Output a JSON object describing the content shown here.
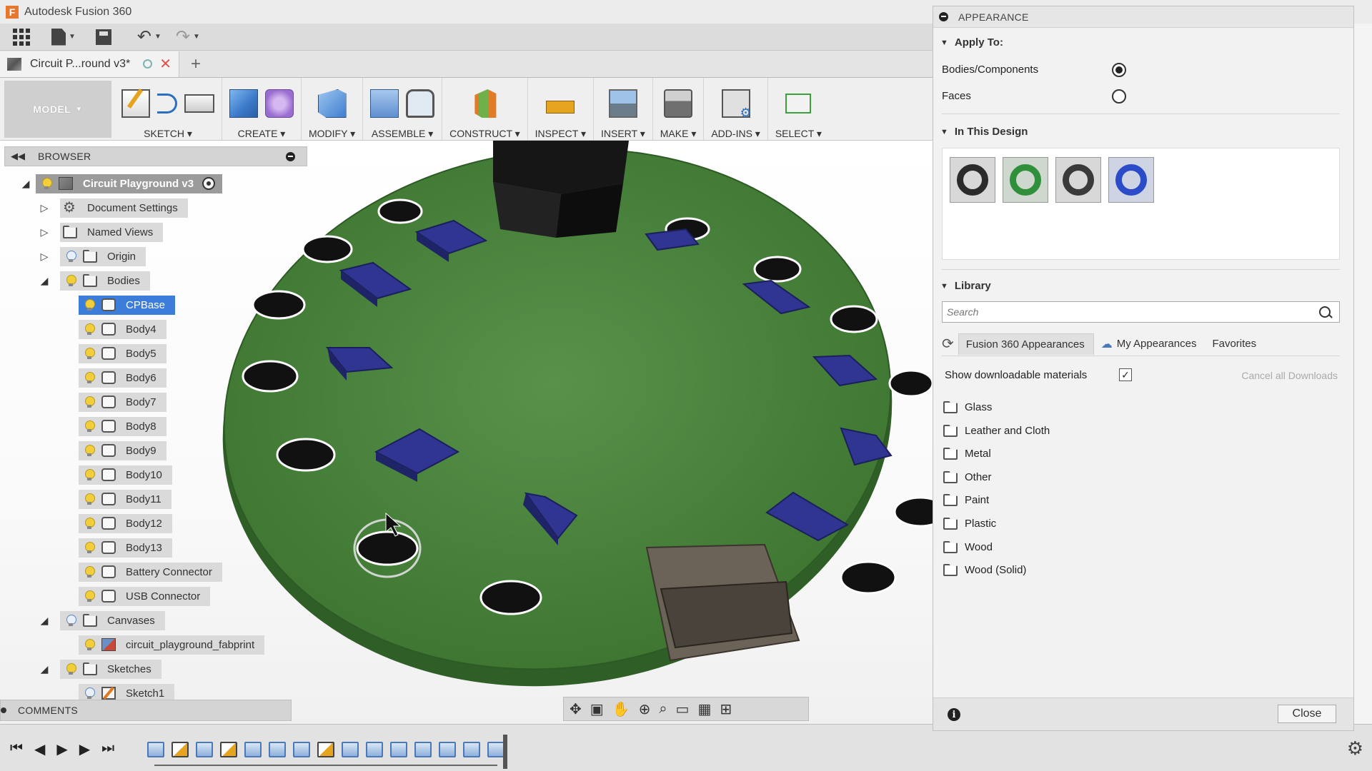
{
  "app": {
    "title": "Autodesk Fusion 360",
    "logo_letter": "F"
  },
  "document_tab": {
    "label": "Circuit P...round v3*",
    "close_glyph": "✕",
    "new_tab_glyph": "+"
  },
  "ribbon": {
    "workspace": "MODEL",
    "groups": [
      {
        "label": "SKETCH ▾"
      },
      {
        "label": "CREATE ▾"
      },
      {
        "label": "MODIFY ▾"
      },
      {
        "label": "ASSEMBLE ▾"
      },
      {
        "label": "CONSTRUCT ▾"
      },
      {
        "label": "INSPECT ▾"
      },
      {
        "label": "INSERT ▾"
      },
      {
        "label": "MAKE ▾"
      },
      {
        "label": "ADD-INS ▾"
      },
      {
        "label": "SELECT ▾"
      }
    ]
  },
  "browser": {
    "title": "BROWSER",
    "root": "Circuit Playground v3",
    "items": [
      {
        "label": "Document Settings"
      },
      {
        "label": "Named Views"
      },
      {
        "label": "Origin"
      },
      {
        "label": "Bodies"
      },
      {
        "label": "CPBase"
      },
      {
        "label": "Body4"
      },
      {
        "label": "Body5"
      },
      {
        "label": "Body6"
      },
      {
        "label": "Body7"
      },
      {
        "label": "Body8"
      },
      {
        "label": "Body9"
      },
      {
        "label": "Body10"
      },
      {
        "label": "Body11"
      },
      {
        "label": "Body12"
      },
      {
        "label": "Body13"
      },
      {
        "label": "Battery Connector"
      },
      {
        "label": "USB Connector"
      },
      {
        "label": "Canvases"
      },
      {
        "label": "circuit_playground_fabprint"
      },
      {
        "label": "Sketches"
      },
      {
        "label": "Sketch1"
      }
    ]
  },
  "comments": {
    "label": "COMMENTS"
  },
  "appearance": {
    "title": "APPEARANCE",
    "apply_to": {
      "heading": "Apply To:",
      "option1": "Bodies/Components",
      "option2": "Faces",
      "selected": "Bodies/Components"
    },
    "in_this_design": {
      "heading": "In This Design",
      "swatch_colors": [
        "#2b2b2b",
        "#2f8f3a",
        "#3a3a3a",
        "#2b4bc8"
      ]
    },
    "library": {
      "heading": "Library",
      "search_placeholder": "Search",
      "tabs": [
        "Fusion 360 Appearances",
        "My Appearances",
        "Favorites"
      ],
      "show_downloadable": "Show downloadable materials",
      "show_downloadable_checked": true,
      "checkmark": "✓",
      "cancel_downloads": "Cancel all Downloads",
      "folders": [
        "Glass",
        "Leather and Cloth",
        "Metal",
        "Other",
        "Paint",
        "Plastic",
        "Wood",
        "Wood (Solid)"
      ]
    },
    "close_label": "Close",
    "info_glyph": "i"
  },
  "colors": {
    "board_green": "#3f7a32",
    "pad_blue": "#2f3590",
    "selection_blue": "#3b7dd8"
  }
}
